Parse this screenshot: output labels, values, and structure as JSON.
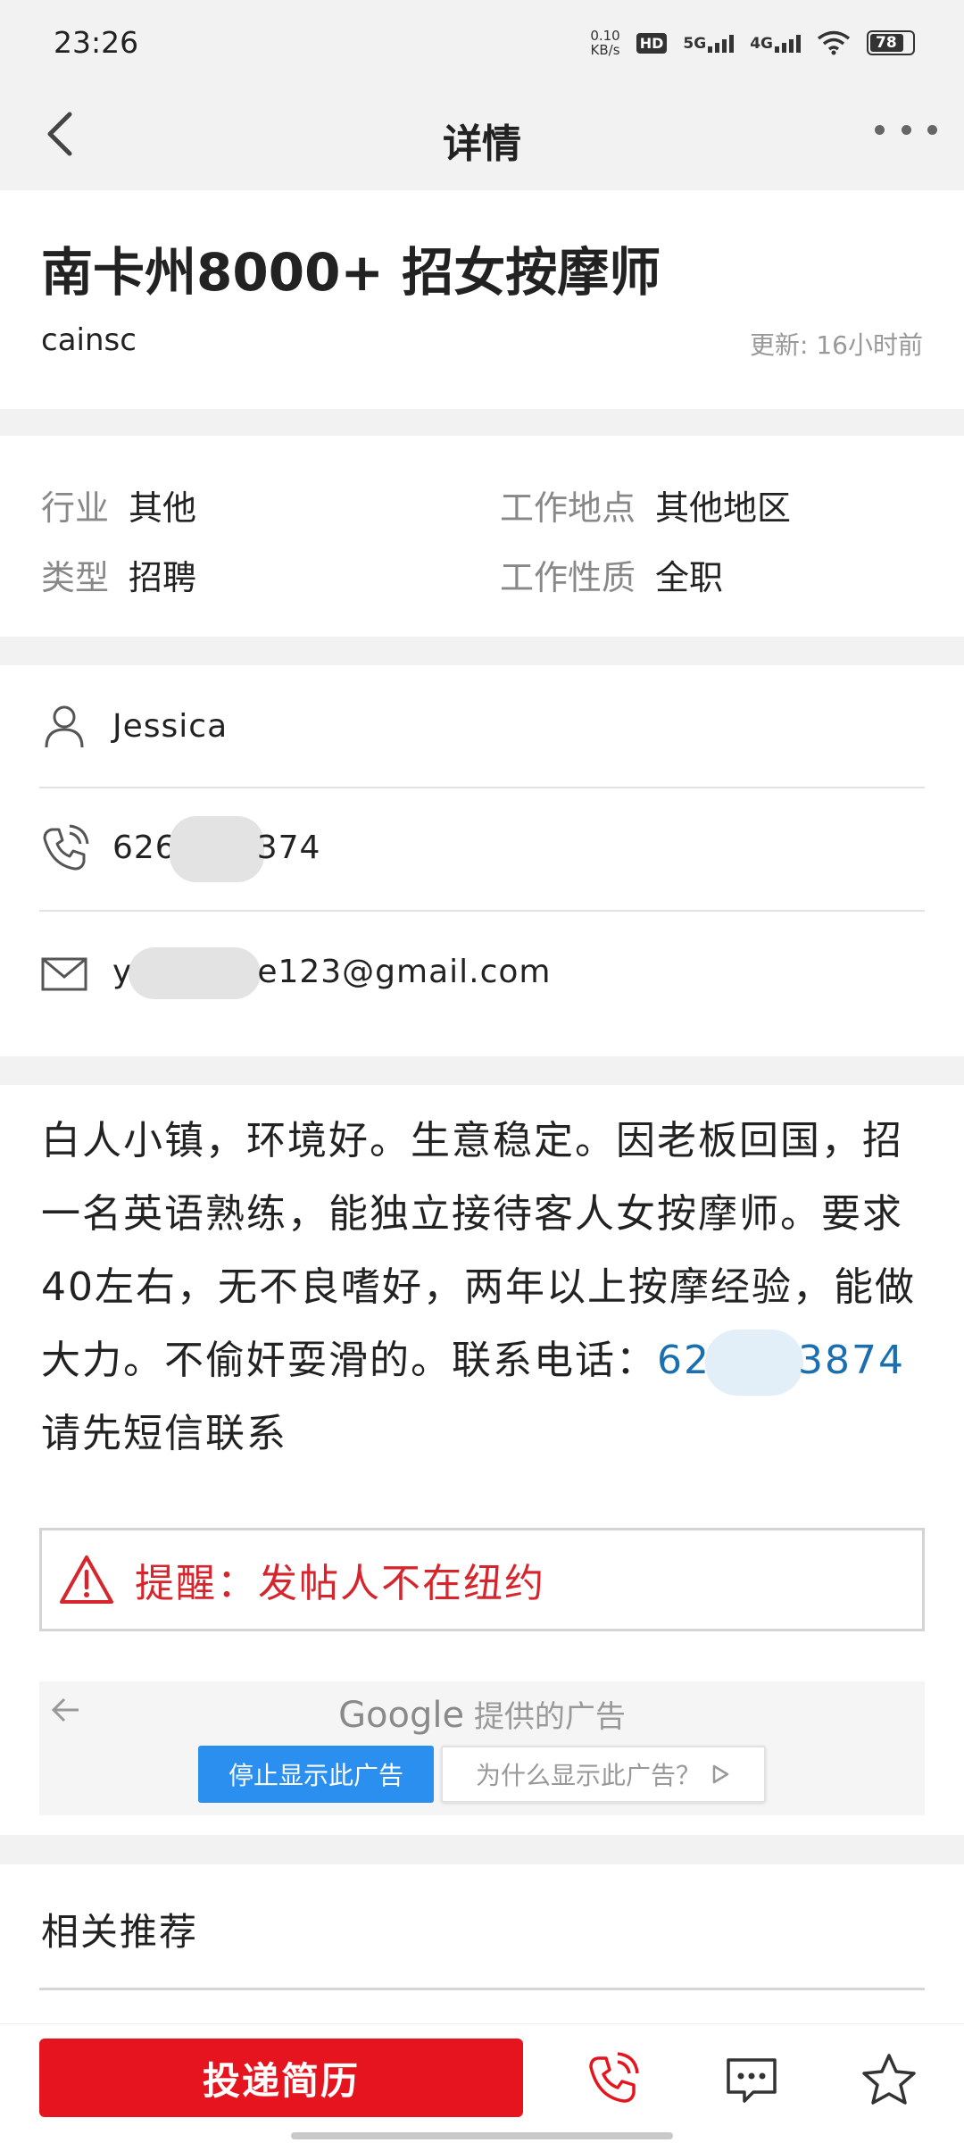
{
  "status_bar": {
    "time": "23:26",
    "net_speed_value": "0.10",
    "net_speed_unit": "KB/s",
    "hd_label": "HD",
    "signal1_label": "5G",
    "signal2_label": "4G",
    "battery": "78"
  },
  "nav": {
    "title": "详情"
  },
  "post": {
    "title": "南卡州8000+ 招女按摩师",
    "author": "cainsc",
    "updated": "更新: 16小时前"
  },
  "meta": {
    "industry_label": "行业",
    "industry_value": "其他",
    "type_label": "类型",
    "type_value": "招聘",
    "location_label": "工作地点",
    "location_value": "其他地区",
    "nature_label": "工作性质",
    "nature_value": "全职"
  },
  "contact": {
    "name": "Jessica",
    "phone_prefix": "626",
    "phone_suffix": "374",
    "email_prefix": "y",
    "email_suffix": "e123@gmail.com"
  },
  "description": {
    "text": "白人小镇，环境好。生意稳定。因老板回国，招一名英语熟练，能独立接待客人女按摩师。要求40左右，无不良嗜好，两年以上按摩经验，能做大力。不偷奸耍滑的。联系电话：",
    "phone_prefix": "62",
    "phone_suffix": "3874",
    "tail": "请先短信联系"
  },
  "warning": {
    "text": "提醒：发帖人不在纽约",
    "color": "#d7252d"
  },
  "ad": {
    "provider_brand": "Google",
    "provider_text": "提供的广告",
    "stop_label": "停止显示此广告",
    "why_label": "为什么显示此广告？"
  },
  "recommend": {
    "title": "相关推荐"
  },
  "bottom": {
    "apply_label": "投递简历",
    "apply_color": "#e6141e",
    "call_icon": "phone-icon",
    "message_icon": "chat-bubble-icon",
    "favorite_icon": "star-icon"
  }
}
